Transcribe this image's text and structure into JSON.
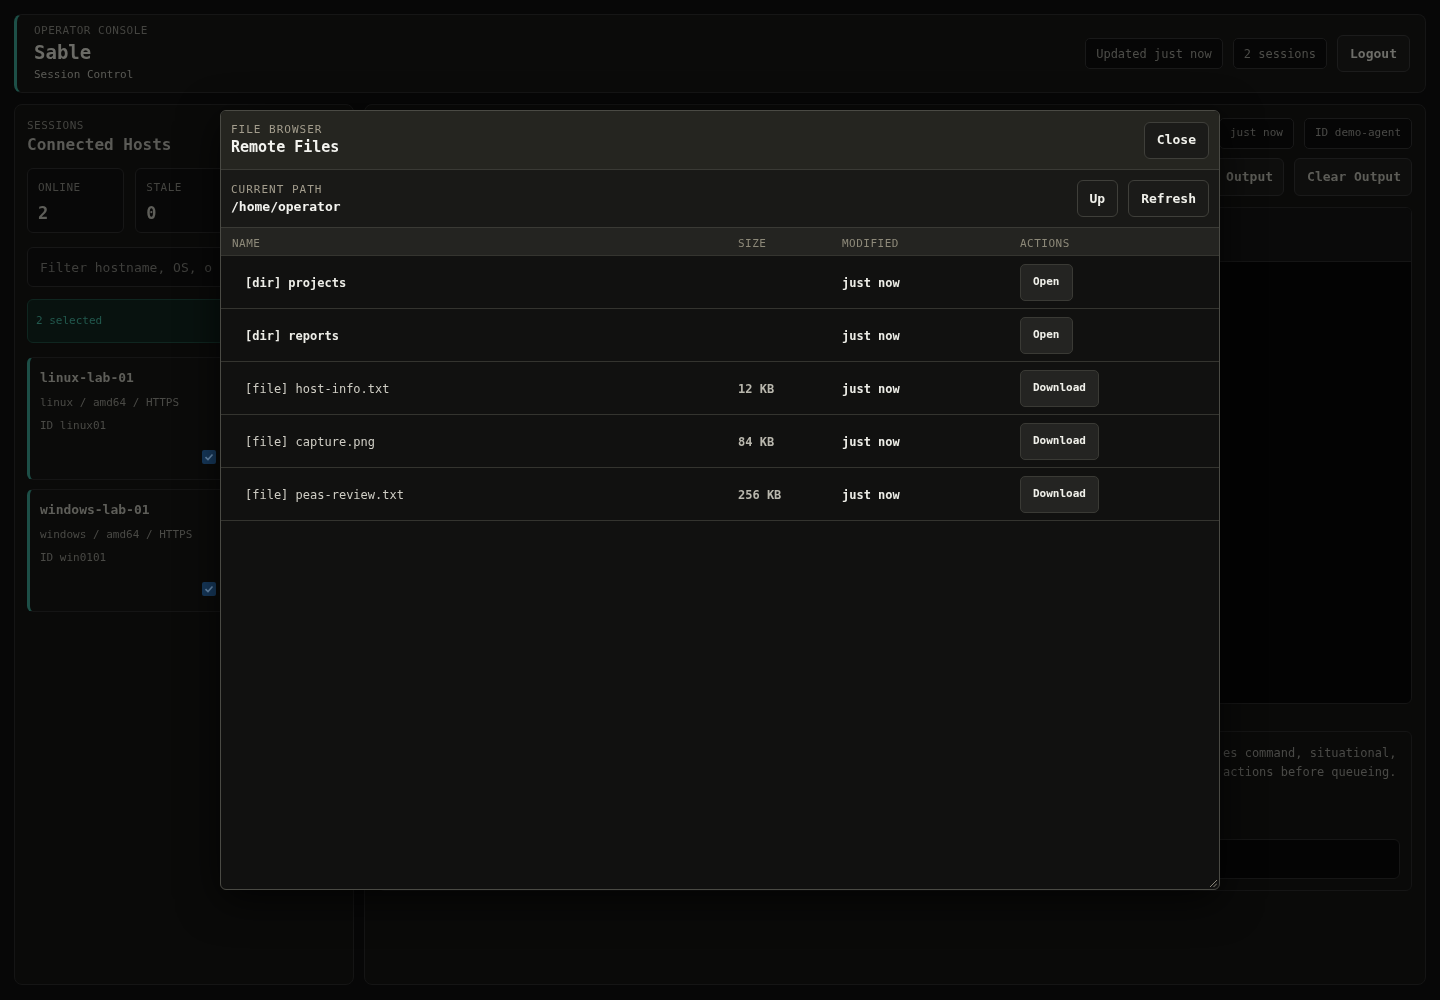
{
  "header": {
    "eyebrow": "OPERATOR CONSOLE",
    "title": "Sable",
    "subtitle": "Session Control",
    "badges": [
      "Updated just now",
      "2 sessions"
    ],
    "logout": "Logout"
  },
  "sessions": {
    "eyebrow": "SESSIONS",
    "title": "Connected Hosts",
    "stats": [
      {
        "label": "ONLINE",
        "value": "2"
      },
      {
        "label": "STALE",
        "value": "0"
      }
    ],
    "filter": {
      "placeholder": "Filter hostname, OS, o"
    },
    "selection": "2 selected",
    "hosts": [
      {
        "name": "linux-lab-01",
        "meta": "linux / amd64 / HTTPS",
        "id": "ID linux01",
        "checked": true
      },
      {
        "name": "windows-lab-01",
        "meta": "windows / amd64 / HTTPS",
        "id": "ID win0101",
        "checked": true
      }
    ]
  },
  "agent_panel": {
    "badges": [
      "just now",
      "ID demo-agent"
    ],
    "buttons": [
      "Output",
      "Clear Output"
    ],
    "notice": "es command, situational, actions before queueing."
  },
  "file_browser": {
    "eyebrow": "FILE BROWSER",
    "title": "Remote Files",
    "close": "Close",
    "path_label": "CURRENT PATH",
    "path": "/home/operator",
    "buttons": [
      "Up",
      "Refresh"
    ],
    "columns": [
      "NAME",
      "SIZE",
      "MODIFIED",
      "ACTIONS"
    ],
    "rows": [
      {
        "kind": "dir",
        "name": "[dir] projects",
        "modified": "just now",
        "action": "Open"
      },
      {
        "kind": "dir",
        "name": "[dir] reports",
        "modified": "just now",
        "action": "Open"
      },
      {
        "kind": "file",
        "name": "[file] host-info.txt",
        "size": "12 KB",
        "modified": "just now",
        "action": "Download"
      },
      {
        "kind": "file",
        "name": "[file] capture.png",
        "size": "84 KB",
        "modified": "just now",
        "action": "Download"
      },
      {
        "kind": "file",
        "name": "[file] peas-review.txt",
        "size": "256 KB",
        "modified": "just now",
        "action": "Download"
      }
    ]
  }
}
